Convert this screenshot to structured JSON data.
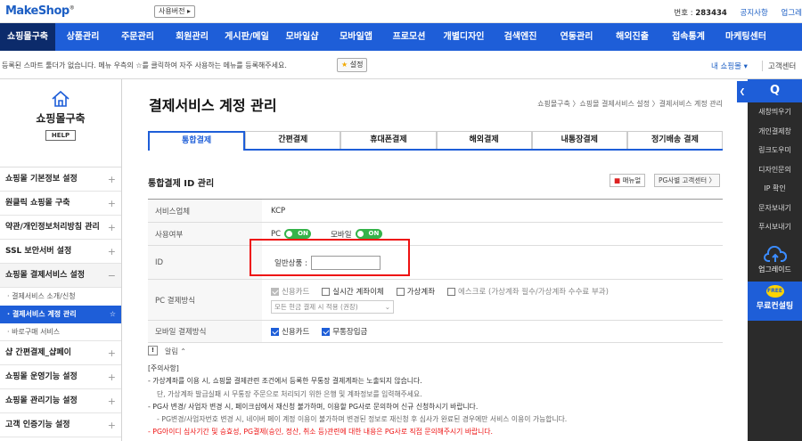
{
  "topbar": {
    "logo": "MakeShop",
    "logo_sup": "®",
    "version_button": "사용버전 ▸",
    "account_label": "번호 : ",
    "account_no": "283434",
    "notice_link": "공지사항",
    "upgrade_link": "업그레"
  },
  "mainnav": [
    "쇼핑몰구축",
    "상품관리",
    "주문관리",
    "회원관리",
    "게시판/메일",
    "모바일샵",
    "모바일앱",
    "프로모션",
    "개별디자인",
    "검색엔진",
    "연동관리",
    "해외진출",
    "접속통계",
    "마케팅센터"
  ],
  "favbar": {
    "text": "등록된 스마트 툴더가 없습니다. 메뉴 우측의 ☆를 클릭하여 자주 사용하는 메뉴를 등록해주세요.",
    "setting_button": "설정",
    "my_shop": "내 쇼핑몰 ▾",
    "customer_center": "고객센터"
  },
  "sidebar": {
    "title": "쇼핑몰구축",
    "help": "HELP",
    "items": [
      {
        "label": "쇼핑몰 기본정보 설정",
        "mark": "+"
      },
      {
        "label": "원클릭 쇼핑몰 구축",
        "mark": "+"
      },
      {
        "label": "약관/개인정보처리방침 관리",
        "mark": "+"
      },
      {
        "label": "SSL 보안서버 설정",
        "mark": "+"
      },
      {
        "label": "쇼핑몰 결제서비스 설정",
        "mark": "−"
      }
    ],
    "subitems": [
      "· 결제서비스 소개/신청",
      "· 결제서비스 계정 관리",
      "· 바로구매 서비스"
    ],
    "items2": [
      {
        "label": "샵 간편결제_샵페이",
        "mark": "+"
      },
      {
        "label": "쇼핑몰 운영기능 설정",
        "mark": "+"
      },
      {
        "label": "쇼핑몰 관리기능 설정",
        "mark": "+"
      },
      {
        "label": "고객 인증기능 설정",
        "mark": "+"
      },
      {
        "label": "샵 도메인 안내",
        "mark": "+"
      }
    ]
  },
  "page": {
    "title": "결제서비스 계정 관리",
    "breadcrumb": "쇼핑몰구축 〉쇼핑몰 결제서비스 설정 〉결제서비스 계정 관리",
    "tabs": [
      "통합결제",
      "간편결제",
      "휴대폰결제",
      "해외결제",
      "내통장결제",
      "정기배송 결제"
    ],
    "section_title": "통합결제 ID 관리",
    "manual_button": "매뉴얼",
    "pg_button": "PG사별 고객센터 〉",
    "form": {
      "provider_label": "서비스업체",
      "provider_value": "KCP",
      "usage_label": "사용여부",
      "pc_label": "PC",
      "mobile_label": "모바일",
      "toggle_on": "ON",
      "id_label": "ID",
      "id_field_label": "일반상품 :",
      "id_value": "",
      "pc_method_label": "PC 결제방식",
      "pc_methods": [
        {
          "label": "신용카드",
          "checked": true,
          "disabled": true
        },
        {
          "label": "실시간 계좌이체",
          "checked": false,
          "disabled": false
        },
        {
          "label": "가상계좌",
          "checked": false,
          "disabled": false
        },
        {
          "label": "에스크로 (가상계좌 필수/가상계좌 수수료 부과)",
          "checked": false,
          "disabled": true
        }
      ],
      "pc_select": "모든 현금 결제 시 적용 (권장)",
      "mobile_method_label": "모바일 결제방식",
      "mobile_methods": [
        {
          "label": "신용카드",
          "checked": true
        },
        {
          "label": "무통장입금",
          "checked": true
        }
      ]
    },
    "notice_label": "알림  ⌃",
    "notes": [
      "[주의사항]",
      "- 가상계좌를 이용 시, 쇼핑몰 결제관련 조건에서 등록한 무통장 결제계좌는 노출되지 않습니다.",
      "단, 가상계좌 발급실패 시 무통장 주문으로 처리되기 위한 은행 및 계좌정보를 입력해주세요.",
      "- PG사 변경/ 사업자 변경 시, 페이크샵에서 재신청 불가하며, 이용할 PG사로 문의하여 신규 신청하시기 바랍니다.",
      "- PG변경/사업자번호 변경 시, 네이버 페이 계정 이용이 불가하며 변경된 정보로 재신청 후 심사가 완료된 경우에만 서비스 이용이 가능합니다.",
      "- PG아이디 심사기간 및 승효성, PG결제(승인, 정산, 취소 등)관련에 대한 내용은 PG사로 직접 문의해주시기 바랍니다."
    ]
  },
  "rightbar": {
    "search": "Q",
    "items": [
      "새창띄우기",
      "개인결제창",
      "링크도우미",
      "디자인문의",
      "IP 확인",
      "문자보내기",
      "푸시보내기"
    ],
    "upgrade": "업그레이드",
    "free_badge": "FREE",
    "free_text": "무료컨설팅"
  },
  "colors": {
    "primary": "#1e5ed8",
    "nav_active": "#0c2b6b",
    "toggle_on": "#35b34a",
    "highlight": "#e11111"
  }
}
